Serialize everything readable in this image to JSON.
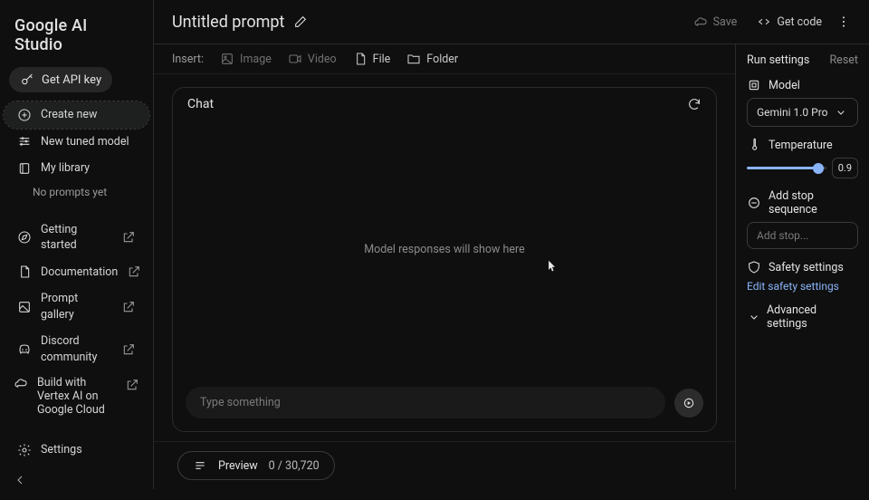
{
  "brand": "Google AI Studio",
  "sidebar": {
    "api_key": "Get API key",
    "create_new": "Create new",
    "new_tuned": "New tuned model",
    "my_library": "My library",
    "no_prompts": "No prompts yet",
    "getting_started": "Getting started",
    "documentation": "Documentation",
    "prompt_gallery": "Prompt gallery",
    "discord": "Discord community",
    "vertex": "Build with Vertex AI on Google Cloud",
    "settings": "Settings"
  },
  "header": {
    "title": "Untitled prompt",
    "save": "Save",
    "get_code": "Get code"
  },
  "insert": {
    "label": "Insert:",
    "image": "Image",
    "video": "Video",
    "file": "File",
    "folder": "Folder"
  },
  "chat": {
    "title": "Chat",
    "placeholder_body": "Model responses will show here",
    "input_placeholder": "Type something"
  },
  "preview": {
    "label": "Preview",
    "count": "0 / 30,720"
  },
  "settings": {
    "heading": "Run settings",
    "reset": "Reset",
    "model_label": "Model",
    "model_value": "Gemini 1.0 Pro",
    "temperature_label": "Temperature",
    "temperature_value": "0.9",
    "stop_label": "Add stop sequence",
    "stop_placeholder": "Add stop...",
    "safety_label": "Safety settings",
    "safety_edit": "Edit safety settings",
    "advanced": "Advanced settings"
  }
}
